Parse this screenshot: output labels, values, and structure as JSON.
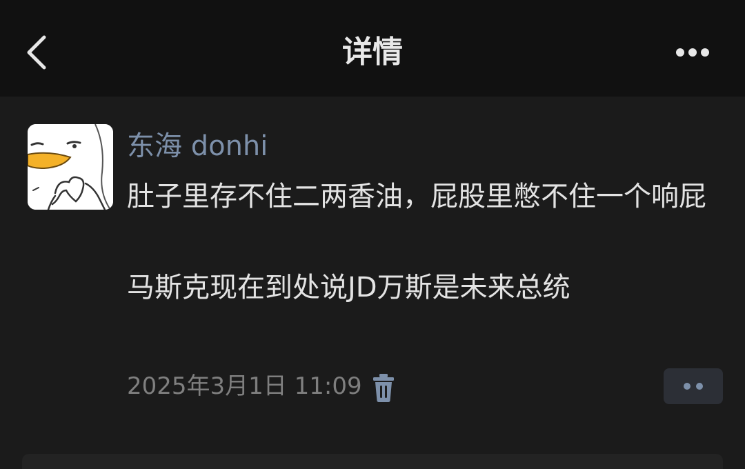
{
  "header": {
    "title": "详情",
    "back_icon": "chevron-left-icon",
    "more_icon": "more-horizontal-icon"
  },
  "post": {
    "author": "东海 donhi",
    "avatar_icon": "duck-heart-avatar",
    "text": "肚子里存不住二两香油，屁股里憋不住一个响屁\n\n马斯克现在到处说JD万斯是未来总统",
    "time": "2025年3月1日 11:09",
    "delete_icon": "trash-icon",
    "action_icon": "two-dots-icon"
  },
  "colors": {
    "background": "#1b1b1b",
    "topbar": "#111111",
    "author_name": "#7d90aa",
    "text": "#e3e3e3",
    "meta": "#7f7f7f",
    "action_button_bg": "#2c2f36"
  }
}
